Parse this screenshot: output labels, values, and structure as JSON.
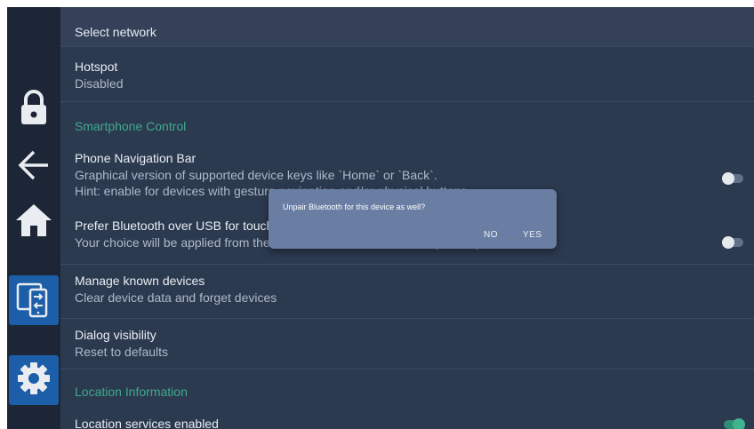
{
  "sidebar": {
    "items": [
      {
        "name": "lock",
        "icon": "lock-icon"
      },
      {
        "name": "back",
        "icon": "arrow-left-icon"
      },
      {
        "name": "home",
        "icon": "home-icon"
      },
      {
        "name": "devices",
        "icon": "device-switch-icon",
        "selected": true
      },
      {
        "name": "settings",
        "icon": "gear-icon",
        "selected": true
      }
    ]
  },
  "settings": {
    "select_network": {
      "title": "Select network"
    },
    "hotspot": {
      "title": "Hotspot",
      "subtitle": "Disabled"
    },
    "section_smartphone": "Smartphone Control",
    "phone_nav": {
      "title": "Phone Navigation Bar",
      "line1": "Graphical version of supported device keys like `Home` or `Back`.",
      "line2": "Hint: enable for devices with gesture navigation and/or physical buttons.",
      "toggle": false
    },
    "prefer_bt": {
      "title": "Prefer Bluetooth over USB for touch input",
      "subtitle": "Your choice will be applied from the next connection on each compatible phone.",
      "toggle": false
    },
    "manage_devices": {
      "title": "Manage known devices",
      "subtitle": "Clear device data and forget devices"
    },
    "dialog_visibility": {
      "title": "Dialog visibility",
      "subtitle": "Reset to defaults"
    },
    "section_location": "Location Information",
    "location_services": {
      "title": "Location services enabled",
      "toggle": true
    }
  },
  "dialog": {
    "message": "Unpair Bluetooth for this device as well?",
    "no_label": "NO",
    "yes_label": "YES"
  },
  "colors": {
    "background": "#2c3a50",
    "sidebar": "#1c2637",
    "accent_green": "#3fa98e",
    "selected_blue": "#1c5fa8",
    "dialog": "#6a7ea4"
  }
}
